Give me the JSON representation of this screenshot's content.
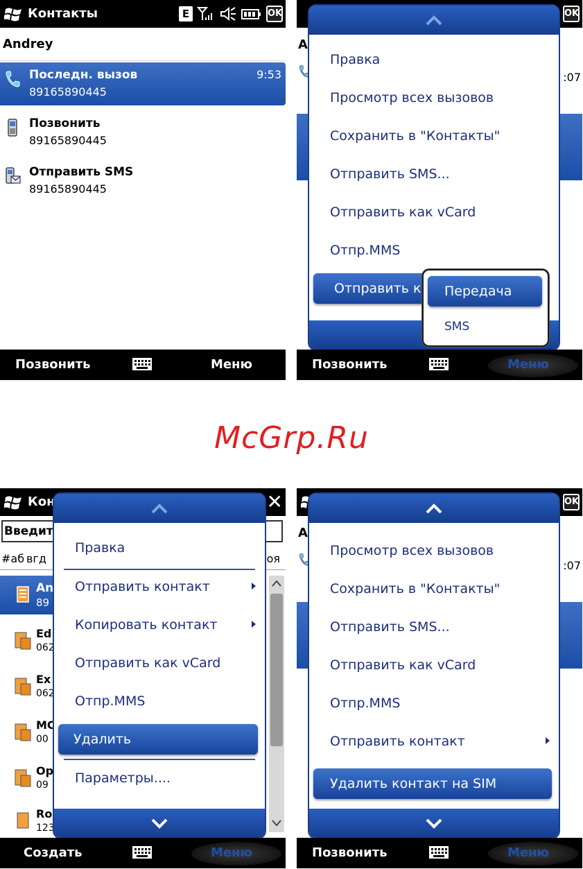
{
  "watermark": "McGrp.Ru",
  "colors": {
    "accent": "#1b4ea6",
    "menu_text": "#1c2f7a",
    "watermark": "#e01f1f"
  },
  "screen1": {
    "status": {
      "title": "Контакты",
      "network": "E",
      "ok": "OK"
    },
    "contact_name": "Andrey",
    "rows": [
      {
        "label": "Последн. вызов",
        "value": "89165890445",
        "time": "9:53",
        "icon": "phone-call-icon"
      },
      {
        "label": "Позвонить",
        "value": "89165890445",
        "icon": "mobile-phone-icon"
      },
      {
        "label": "Отправить SMS",
        "value": "89165890445",
        "icon": "sms-icon"
      }
    ],
    "softkeys": {
      "left": "Позвонить",
      "right": "Меню"
    }
  },
  "screen2": {
    "status": {
      "ok": "OK"
    },
    "bg": {
      "name_frag": "An",
      "time_frag": ":07"
    },
    "menu": [
      "Правка",
      "Просмотр всех вызовов",
      "Сохранить в \"Контакты\"",
      "Отправить SMS...",
      "Отправить как vCard",
      "Отпр.MMS",
      "Отправить к"
    ],
    "submenu": [
      "Передача",
      "SMS"
    ],
    "softkeys": {
      "left": "Позвонить",
      "right": "Меню"
    }
  },
  "screen3": {
    "status": {
      "title_frag": "Конт"
    },
    "search_frag": "Введит",
    "tabs_frag": {
      "left1": "#аб",
      "left2": "вгд",
      "right": "оя"
    },
    "bg_rows": [
      {
        "name": "An",
        "num": "89"
      },
      {
        "name": "Ed",
        "num": "062"
      },
      {
        "name": "Ex",
        "num": "062"
      },
      {
        "name": "MC",
        "num": "00"
      },
      {
        "name": "Op",
        "num": "09"
      },
      {
        "name": "Ro",
        "num": "123"
      }
    ],
    "menu": [
      {
        "label": "Правка",
        "sub": false
      },
      {
        "label": "Отправить контакт",
        "sub": true
      },
      {
        "label": "Копировать контакт",
        "sub": true
      },
      {
        "label": "Отправить как vCard",
        "sub": false
      },
      {
        "label": "Отпр.MMS",
        "sub": false
      },
      {
        "label": "Удалить",
        "sub": false
      },
      {
        "label": "Параметры....",
        "sub": false
      }
    ],
    "softkeys": {
      "left": "Создать",
      "right": "Меню"
    }
  },
  "screen4": {
    "status": {
      "ok": "OK"
    },
    "bg": {
      "name_frag": "An",
      "time_frag": ":07"
    },
    "menu": [
      {
        "label": "Просмотр всех вызовов",
        "sub": false
      },
      {
        "label": "Сохранить в \"Контакты\"",
        "sub": false
      },
      {
        "label": "Отправить SMS...",
        "sub": false
      },
      {
        "label": "Отправить как vCard",
        "sub": false
      },
      {
        "label": "Отпр.MMS",
        "sub": false
      },
      {
        "label": "Отправить контакт",
        "sub": true
      },
      {
        "label": "Удалить контакт на SIM",
        "sub": false
      }
    ],
    "softkeys": {
      "left": "Позвонить",
      "right": "Меню"
    }
  }
}
